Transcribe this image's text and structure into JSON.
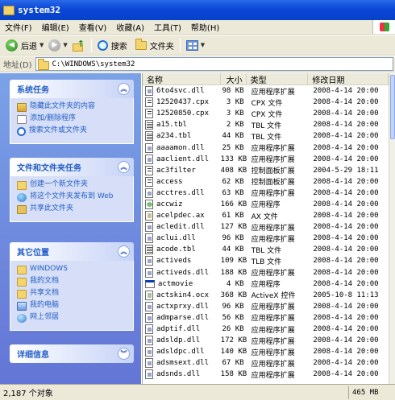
{
  "window": {
    "title": "system32"
  },
  "menu": [
    "文件(F)",
    "编辑(E)",
    "查看(V)",
    "收藏(A)",
    "工具(T)",
    "帮助(H)"
  ],
  "toolbar": {
    "back": "后退",
    "search": "搜索",
    "folders": "文件夹"
  },
  "address": {
    "label": "地址(D)",
    "path": "C:\\WINDOWS\\system32"
  },
  "panes": {
    "system_tasks": {
      "title": "系统任务",
      "items": [
        "隐藏此文件夹的内容",
        "添加/删除程序",
        "搜索文件或文件夹"
      ]
    },
    "file_tasks": {
      "title": "文件和文件夹任务",
      "items": [
        "创建一个新文件夹",
        "将这个文件夹发布到 Web",
        "共享此文件夹"
      ]
    },
    "other_places": {
      "title": "其它位置",
      "items": [
        "WINDOWS",
        "我的文档",
        "共享文档",
        "我的电脑",
        "网上邻居"
      ]
    },
    "details": {
      "title": "详细信息"
    }
  },
  "list": {
    "columns": {
      "name": "名称",
      "size": "大小",
      "type": "类型",
      "date": "修改日期"
    },
    "rows": [
      {
        "name": "6to4svc.dll",
        "size": "98 KB",
        "type": "应用程序扩展",
        "date": "2008-4-14 20:00",
        "icon": "dll"
      },
      {
        "name": "12520437.cpx",
        "size": "3 KB",
        "type": "CPX 文件",
        "date": "2008-4-14 20:00",
        "icon": "cpx"
      },
      {
        "name": "12520850.cpx",
        "size": "3 KB",
        "type": "CPX 文件",
        "date": "2008-4-14 20:00",
        "icon": "cpx"
      },
      {
        "name": "a15.tbl",
        "size": "2 KB",
        "type": "TBL 文件",
        "date": "2008-4-14 20:00",
        "icon": "tbl"
      },
      {
        "name": "a234.tbl",
        "size": "44 KB",
        "type": "TBL 文件",
        "date": "2008-4-14 20:00",
        "icon": "tbl"
      },
      {
        "name": "aaaamon.dll",
        "size": "25 KB",
        "type": "应用程序扩展",
        "date": "2008-4-14 20:00",
        "icon": "dll"
      },
      {
        "name": "aaclient.dll",
        "size": "133 KB",
        "type": "应用程序扩展",
        "date": "2008-4-14 20:00",
        "icon": "dll"
      },
      {
        "name": "ac3filter",
        "size": "408 KB",
        "type": "控制面板扩展",
        "date": "2004-5-29 18:11",
        "icon": "cpx"
      },
      {
        "name": "access",
        "size": "62 KB",
        "type": "控制面板扩展",
        "date": "2008-4-14 20:00",
        "icon": "cpx"
      },
      {
        "name": "acctres.dll",
        "size": "63 KB",
        "type": "应用程序扩展",
        "date": "2008-4-14 20:00",
        "icon": "dll"
      },
      {
        "name": "accwiz",
        "size": "166 KB",
        "type": "应用程序",
        "date": "2008-4-14 20:00",
        "icon": "acm"
      },
      {
        "name": "acelpdec.ax",
        "size": "61 KB",
        "type": "AX 文件",
        "date": "2008-4-14 20:00",
        "icon": "ax"
      },
      {
        "name": "acledit.dll",
        "size": "127 KB",
        "type": "应用程序扩展",
        "date": "2008-4-14 20:00",
        "icon": "dll"
      },
      {
        "name": "aclui.dll",
        "size": "96 KB",
        "type": "应用程序扩展",
        "date": "2008-4-14 20:00",
        "icon": "dll"
      },
      {
        "name": "acode.tbl",
        "size": "44 KB",
        "type": "TBL 文件",
        "date": "2008-4-14 20:00",
        "icon": "tbl"
      },
      {
        "name": "activeds",
        "size": "109 KB",
        "type": "TLB 文件",
        "date": "2008-4-14 20:00",
        "icon": "dll"
      },
      {
        "name": "activeds.dll",
        "size": "188 KB",
        "type": "应用程序扩展",
        "date": "2008-4-14 20:00",
        "icon": "dll"
      },
      {
        "name": "actmovie",
        "size": "4 KB",
        "type": "应用程序",
        "date": "2008-4-14 20:00",
        "icon": "exe"
      },
      {
        "name": "actskin4.ocx",
        "size": "368 KB",
        "type": "ActiveX 控件",
        "date": "2005-10-8 11:13",
        "icon": "ocx"
      },
      {
        "name": "actxprxy.dll",
        "size": "96 KB",
        "type": "应用程序扩展",
        "date": "2008-4-14 20:00",
        "icon": "dll"
      },
      {
        "name": "admparse.dll",
        "size": "56 KB",
        "type": "应用程序扩展",
        "date": "2008-4-14 20:00",
        "icon": "dll"
      },
      {
        "name": "adptif.dll",
        "size": "26 KB",
        "type": "应用程序扩展",
        "date": "2008-4-14 20:00",
        "icon": "dll"
      },
      {
        "name": "adsldp.dll",
        "size": "172 KB",
        "type": "应用程序扩展",
        "date": "2008-4-14 20:00",
        "icon": "dll"
      },
      {
        "name": "adsldpc.dll",
        "size": "140 KB",
        "type": "应用程序扩展",
        "date": "2008-4-14 20:00",
        "icon": "dll"
      },
      {
        "name": "adsmsext.dll",
        "size": "67 KB",
        "type": "应用程序扩展",
        "date": "2008-4-14 20:00",
        "icon": "dll"
      },
      {
        "name": "adsnds.dll",
        "size": "158 KB",
        "type": "应用程序扩展",
        "date": "2008-4-14 20:00",
        "icon": "dll"
      }
    ]
  },
  "status": {
    "count": "2,187 个对象",
    "size": "465 MB"
  }
}
